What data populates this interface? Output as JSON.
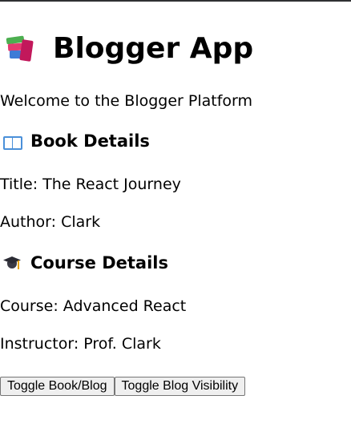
{
  "header": {
    "title": "Blogger App",
    "icon": "books-icon"
  },
  "welcome_text": "Welcome to the Blogger Platform",
  "book_section": {
    "heading": "Book Details",
    "icon": "open-book-icon",
    "title_line": "Title: The React Journey",
    "author_line": "Author: Clark"
  },
  "course_section": {
    "heading": "Course Details",
    "icon": "graduation-cap-icon",
    "course_line": "Course: Advanced React",
    "instructor_line": "Instructor: Prof. Clark"
  },
  "buttons": {
    "toggle_book_blog": "Toggle Book/Blog",
    "toggle_blog_visibility": "Toggle Blog Visibility"
  }
}
